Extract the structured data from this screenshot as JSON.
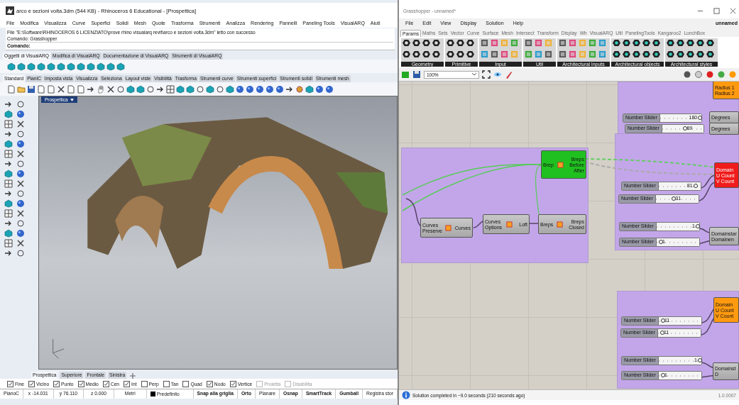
{
  "rhino": {
    "title": "arco e sezioni volta.3dm (544 KB) - Rhinoceros 6 Educational - [Prospettica]",
    "menu": [
      "File",
      "Modifica",
      "Visualizza",
      "Curve",
      "Superfici",
      "Solidi",
      "Mesh",
      "Quote",
      "Trasforma",
      "Strumenti",
      "Analizza",
      "Rendering",
      "Pannelli",
      "Paneling Tools",
      "VisualARQ",
      "Aiuti"
    ],
    "command_history": [
      "File \"E:\\Software\\RHINOCEROS 6 LICENZIATO\\prove rhino visualarq revit\\arco e sezioni volta.3dm\" letto con successo",
      "Comando: Grasshopper"
    ],
    "command_prompt": "Comando:",
    "visualarq_tabs": [
      {
        "label": "Oggetti di VisualARQ",
        "selected": true
      },
      {
        "label": "Modifica di VisualARQ",
        "selected": false
      },
      {
        "label": "Documentazione di VisualARQ",
        "selected": false
      },
      {
        "label": "Strumenti di VisualARQ",
        "selected": false
      }
    ],
    "toolbar_tabs": [
      {
        "label": "Standard",
        "selected": true
      },
      {
        "label": "PianiC",
        "selected": false
      },
      {
        "label": "Imposta vista",
        "selected": false
      },
      {
        "label": "Visualizza",
        "selected": false
      },
      {
        "label": "Seleziona",
        "selected": false
      },
      {
        "label": "Layout viste",
        "selected": false
      },
      {
        "label": "Visibilità",
        "selected": false
      },
      {
        "label": "Trasforma",
        "selected": false
      },
      {
        "label": "Strumenti curve",
        "selected": false
      },
      {
        "label": "Strumenti superfici",
        "selected": false
      },
      {
        "label": "Strumenti solidi",
        "selected": false
      },
      {
        "label": "Strumenti mesh",
        "selected": false
      }
    ],
    "viewport": {
      "title": "Prospettica"
    },
    "viewport_tabs": [
      {
        "label": "Prospettica",
        "selected": true
      },
      {
        "label": "Superiore",
        "selected": false
      },
      {
        "label": "Frontale",
        "selected": false
      },
      {
        "label": "Sinistra",
        "selected": false
      }
    ],
    "osnaps": [
      {
        "label": "Fine",
        "checked": true,
        "disabled": false
      },
      {
        "label": "Vicino",
        "checked": true,
        "disabled": false
      },
      {
        "label": "Punto",
        "checked": true,
        "disabled": false
      },
      {
        "label": "Medio",
        "checked": true,
        "disabled": false
      },
      {
        "label": "Cen",
        "checked": true,
        "disabled": false
      },
      {
        "label": "Int",
        "checked": true,
        "disabled": false
      },
      {
        "label": "Perp",
        "checked": false,
        "disabled": false
      },
      {
        "label": "Tan",
        "checked": false,
        "disabled": false
      },
      {
        "label": "Quad",
        "checked": false,
        "disabled": false
      },
      {
        "label": "Nodo",
        "checked": true,
        "disabled": false
      },
      {
        "label": "Vertice",
        "checked": true,
        "disabled": false
      },
      {
        "label": "Proietta",
        "checked": false,
        "disabled": true
      },
      {
        "label": "Disabilita",
        "checked": false,
        "disabled": true
      }
    ],
    "status": {
      "plane": "PianoC",
      "x": "x -14.031",
      "y": "y 76.110",
      "z": "z 0.000",
      "units": "Metri",
      "layer": "Predefinito",
      "toggles": [
        {
          "label": "Snap alla griglia",
          "on": true
        },
        {
          "label": "Orto",
          "on": true
        },
        {
          "label": "Planare",
          "on": false
        },
        {
          "label": "Osnap",
          "on": true
        },
        {
          "label": "SmartTrack",
          "on": true
        },
        {
          "label": "Gumball",
          "on": true
        },
        {
          "label": "Registra stor",
          "on": false
        }
      ]
    }
  },
  "grasshopper": {
    "title": "Grasshopper - unnamed*",
    "menu": [
      "File",
      "Edit",
      "View",
      "Display",
      "Solution",
      "Help"
    ],
    "document": "unnamed",
    "tabs": [
      {
        "label": "Params",
        "selected": true
      },
      {
        "label": "Maths",
        "selected": false
      },
      {
        "label": "Sets",
        "selected": false
      },
      {
        "label": "Vector",
        "selected": false
      },
      {
        "label": "Curve",
        "selected": false
      },
      {
        "label": "Surface",
        "selected": false
      },
      {
        "label": "Mesh",
        "selected": false
      },
      {
        "label": "Intersect",
        "selected": false
      },
      {
        "label": "Transform",
        "selected": false
      },
      {
        "label": "Display",
        "selected": false
      },
      {
        "label": "Wb",
        "selected": false
      },
      {
        "label": "VisualARQ",
        "selected": false
      },
      {
        "label": "Util",
        "selected": false
      },
      {
        "label": "PanelingTools",
        "selected": false
      },
      {
        "label": "Kangaroo2",
        "selected": false
      },
      {
        "label": "LunchBox",
        "selected": false
      }
    ],
    "ribbon_groups": [
      "Geometry",
      "Primitive",
      "Input",
      "Util",
      "Architectural inputs",
      "Architectural objects",
      "Architectural styles"
    ],
    "zoom": "100%",
    "components": [
      {
        "selected": true,
        "error": false,
        "warning": false,
        "inputs": [
          "Brep"
        ],
        "outputs": [
          "Breps",
          "Before",
          "After"
        ]
      },
      {
        "selected": false,
        "error": false,
        "warning": false,
        "inputs": [
          "Curves",
          "Preserve"
        ],
        "outputs": [
          "Curves"
        ]
      },
      {
        "selected": false,
        "error": false,
        "warning": false,
        "inputs": [
          "Curves",
          "Options"
        ],
        "outputs": [
          "Loft"
        ]
      },
      {
        "selected": false,
        "error": false,
        "warning": false,
        "inputs": [
          "Breps"
        ],
        "outputs": [
          "Breps",
          "Closed"
        ]
      },
      {
        "selected": false,
        "error": false,
        "warning": true,
        "inputs": [
          "Radius 1",
          "Radius 2"
        ]
      },
      {
        "selected": false,
        "error": false,
        "warning": false,
        "inputs": [
          "Degrees"
        ]
      },
      {
        "selected": false,
        "error": false,
        "warning": false,
        "inputs": [
          "Degrees"
        ]
      },
      {
        "selected": false,
        "error": true,
        "warning": false,
        "inputs": [
          "Domain",
          "U Count",
          "V Count"
        ]
      },
      {
        "selected": false,
        "error": false,
        "warning": false,
        "inputs": [
          "Domainstar",
          "Domainen"
        ]
      },
      {
        "selected": false,
        "error": false,
        "warning": true,
        "inputs": [
          "Domain",
          "U Count",
          "V Count"
        ]
      },
      {
        "selected": false,
        "error": false,
        "warning": false,
        "inputs": [
          "Domainst",
          "D"
        ]
      }
    ],
    "sliders": [
      {
        "label": "Number Slider",
        "value": "180",
        "level": 1
      },
      {
        "label": "Number Slider",
        "value": "69",
        "level": 0.55
      },
      {
        "label": "Number Slider",
        "value": "81",
        "level": 0.9
      },
      {
        "label": "Number Slider",
        "value": "31",
        "level": 0.4
      },
      {
        "label": "Number Slider",
        "value": "1",
        "level": 1
      },
      {
        "label": "Number Slider",
        "value": "1",
        "level": 0.05
      },
      {
        "label": "Number Slider",
        "value": "11",
        "level": 0.05
      },
      {
        "label": "Number Slider",
        "value": "11",
        "level": 0.05
      },
      {
        "label": "Number Slider",
        "value": "1",
        "level": 1
      },
      {
        "label": "Number Slider",
        "value": "1",
        "level": 0.05
      }
    ],
    "status": "Solution completed in ~9.0 seconds (210 seconds ago)",
    "version": "1.0.0007"
  }
}
